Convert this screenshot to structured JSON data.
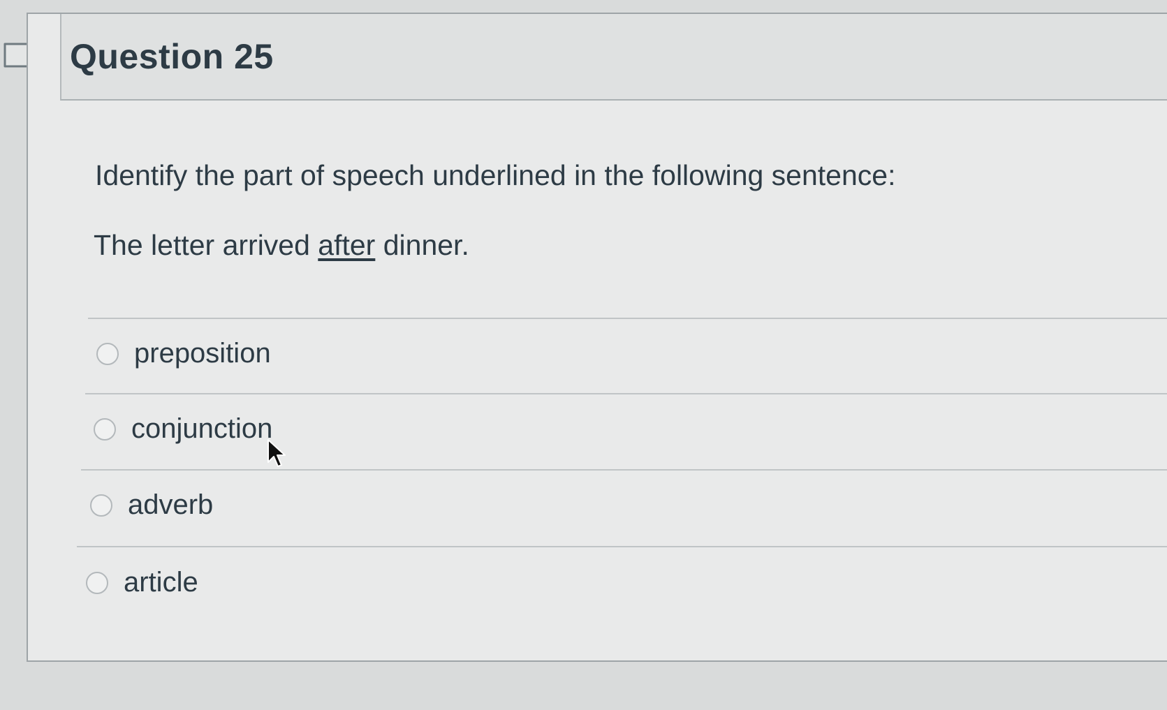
{
  "question": {
    "title": "Question 25",
    "prompt": "Identify the part of speech underlined in the following sentence:",
    "sentence_before": "The letter arrived ",
    "sentence_underlined": "after",
    "sentence_after": " dinner."
  },
  "answers": [
    {
      "label": "preposition"
    },
    {
      "label": "conjunction"
    },
    {
      "label": "adverb"
    },
    {
      "label": "article"
    }
  ],
  "icons": {
    "bookmark": "bookmark-flag-icon",
    "cursor": "mouse-pointer-icon"
  }
}
